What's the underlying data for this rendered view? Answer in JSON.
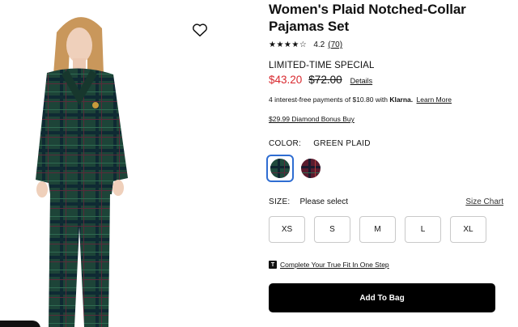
{
  "product": {
    "title": "Women's Plaid Notched-Collar Pajamas Set",
    "rating": {
      "stars": "★★★★☆",
      "value": "4.2",
      "count": "(70)"
    },
    "promo": "LIMITED-TIME SPECIAL",
    "price": {
      "sale": "$43.20",
      "original": "$72.00",
      "details": "Details"
    },
    "klarna": {
      "prefix": "4 interest-free payments of $10.80 with",
      "brand": "Klarna.",
      "learn_more": "Learn More"
    },
    "bonus": "$29.99 Diamond Bonus Buy",
    "color": {
      "label": "COLOR:",
      "value": "GREEN PLAID"
    },
    "size": {
      "label": "SIZE:",
      "value": "Please select",
      "chart": "Size Chart",
      "options": [
        "XS",
        "S",
        "M",
        "L",
        "XL"
      ]
    },
    "fit": {
      "icon": "T",
      "link": "Complete Your True Fit In One Step"
    },
    "add_to_bag": "Add To Bag"
  },
  "colors": {
    "accent_red": "#d8282e",
    "selected_outline": "#2f6dd2",
    "green_plaid": "#1f4a3c",
    "red_plaid": "#5a1b2e"
  },
  "icons": {
    "wishlist": "heart-outline-icon",
    "fit": "truefit-t-icon"
  }
}
